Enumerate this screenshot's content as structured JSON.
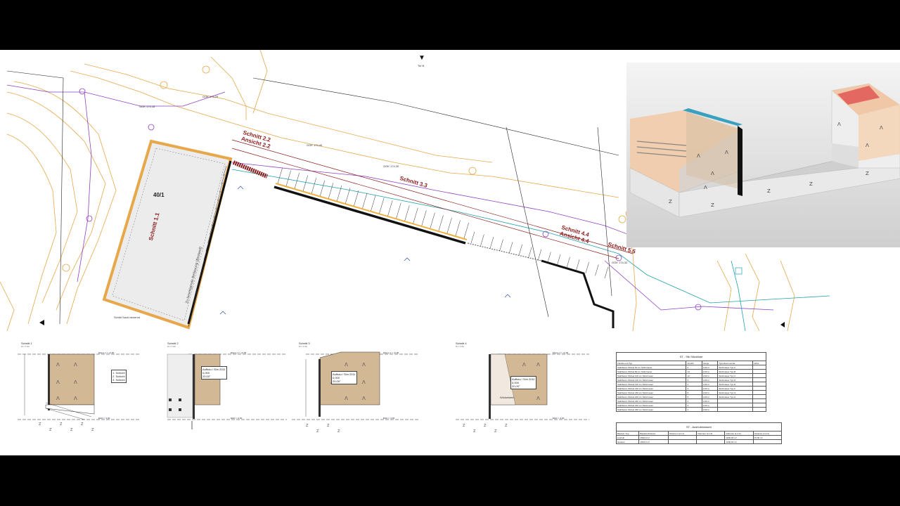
{
  "drawing": {
    "north_label": "Tie B",
    "parcel": {
      "number": "40/1",
      "side_text": "Zu beseitigende Bebauung (Bestand)",
      "bottom_text": "Schild Sach-benennt"
    },
    "section_labels": [
      {
        "id": "2.2",
        "cut": "Schnitt 2.2",
        "view": "Ansicht 2.2"
      },
      {
        "id": "3.3",
        "cut": "Schnitt 3.3",
        "view": ""
      },
      {
        "id": "4.4",
        "cut": "Schnitt 4.4",
        "view": "Ansicht 4.4"
      },
      {
        "id": "5.5",
        "cut": "Schnitt 5.5",
        "view": ""
      },
      {
        "id": "1.1",
        "cut": "Schnitt 1.1",
        "view": ""
      }
    ],
    "point_tags": [
      "GOK 174,18",
      "GOK 174,25",
      "GOK 174,40",
      "GOK 174,30",
      "GOK 174,32"
    ],
    "sections": [
      {
        "title": "Schnitt 1",
        "scale": "M = 1:50",
        "level_top": "Ebene 1 = +0,00",
        "level_bottom": "EG0 = -3,00",
        "callout": [
          "1. Schicht",
          "2. Schicht",
          "3. Schicht"
        ]
      },
      {
        "title": "Schnitt 2",
        "scale": "M = 1:50",
        "level_top": "Ebene 1 = +0,00",
        "level_bottom": "EG0 = -3,00",
        "callout": [
          "Aufbau / Sim 2011",
          "0,000",
          "20,00°"
        ]
      },
      {
        "title": "Schnitt 3",
        "scale": "M = 1:50",
        "level_top": "Ebene 1 = +0,00",
        "level_bottom": "EG0 = -3,00",
        "callout": [
          "Aufbau / Sim 2011",
          "0,000",
          "20,00°"
        ]
      },
      {
        "title": "Schnitt 4",
        "scale": "M = 1:50",
        "level_top": "Ebene 1 = +0,00",
        "level_bottom": "EG0 = -3,00",
        "callout": [
          "Aufbau / Sim 2011",
          "0,000",
          "20,00°"
        ],
        "extra": "Winkelstein"
      }
    ]
  },
  "schedule1": {
    "title": "ST - Stk Stückliste",
    "headers": [
      "Familie und Typ",
      "Anzahl",
      "Länge",
      "Typenkommentar",
      "Höhe"
    ],
    "rows": [
      [
        "Stahlbeton Winkel 60 cm Stützmauer",
        "6",
        "2,00 m",
        "Stützmauer Typ A",
        ""
      ],
      [
        "Stahlbeton Winkel 80 cm Stützmauer",
        "14",
        "2,00 m",
        "Stützmauer Typ B",
        ""
      ],
      [
        "Stahlbeton Winkel 100 cm Stützmauer",
        "12",
        "2,00 m",
        "Stützmauer Typ C",
        ""
      ],
      [
        "Stahlbeton Winkel 120 cm Stützmauer",
        "3",
        "2,00 m",
        "Stützmauer Typ D",
        ""
      ],
      [
        "Stahlbeton Winkel 140 cm Stützmauer",
        "4",
        "2,00 m",
        "Stützmauer Typ E",
        ""
      ],
      [
        "Stahlbeton Winkel 160 cm Stützmauer",
        "3",
        "2,00 m",
        "Stützmauer Typ F",
        ""
      ],
      [
        "Stahlbeton Winkel 180 cm Stützmauer",
        "8",
        "2,00 m",
        "Stützmauer Typ G",
        ""
      ],
      [
        "Stahlbeton Winkel 200 cm Stützmauer",
        "5",
        "2,00 m",
        "Stützmauer Typ H",
        ""
      ],
      [
        "Stahlbeton Winkel 220 cm Stützmauer",
        "2",
        "2,00 m",
        "",
        ""
      ],
      [
        "Stahlbeton Winkel 240 cm Stützmauer",
        "3",
        "2,00 m",
        "",
        ""
      ],
      [
        "Stahlbeton Winkel 260 cm Stützmauer",
        "1",
        "2,00 m",
        "",
        ""
      ]
    ]
  },
  "schedule2": {
    "title": "ST - Aushubmassen",
    "headers": [
      "Bauteil / Typ",
      "Bauteil-Volumen",
      "Volumen (1:1:1)",
      "Volumen (1:1:2)",
      "Volumen (1:1:3)",
      "Volumen (1:1:4)"
    ],
    "rows": [
      [
        "Aushub",
        "1534,0 m³",
        "",
        "",
        "1200,00 m³",
        "15,00 m³"
      ],
      [
        "Gesamt",
        "1534,0 m³",
        "",
        "",
        "1200,00 m³",
        ""
      ]
    ]
  },
  "colors": {
    "background": "#000000",
    "sheet": "#ffffff",
    "soil": "#d3b896",
    "contour": "#e6a84a",
    "boundary": "#9040c0",
    "water": "#20a0b0",
    "section_label": "#8a1a1a"
  }
}
